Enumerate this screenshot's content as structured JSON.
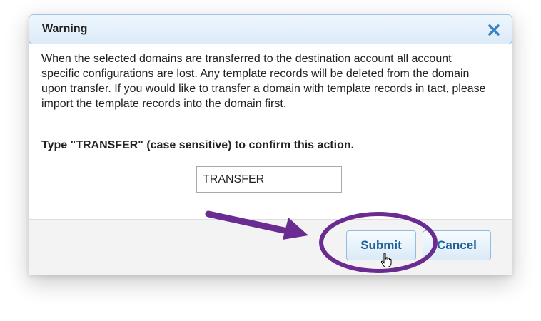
{
  "dialog": {
    "title": "Warning",
    "close_icon": "close-x-icon",
    "message": "When the selected domains are transferred to the destination account all account specific configurations are lost. Any template records will be deleted from the domain upon transfer. If you would like to transfer a domain with template records in tact, please import the template records into the domain first.",
    "prompt": "Type \"TRANSFER\" (case sensitive) to confirm this action.",
    "input_value": "TRANSFER",
    "submit_label": "Submit",
    "cancel_label": "Cancel"
  },
  "annotation": {
    "arrow_color": "#6b2c91",
    "highlight_color": "#6b2c91"
  },
  "colors": {
    "title_bar_border": "#9fc4e4",
    "button_text": "#1d5f99",
    "close_icon": "#3b82c4"
  }
}
